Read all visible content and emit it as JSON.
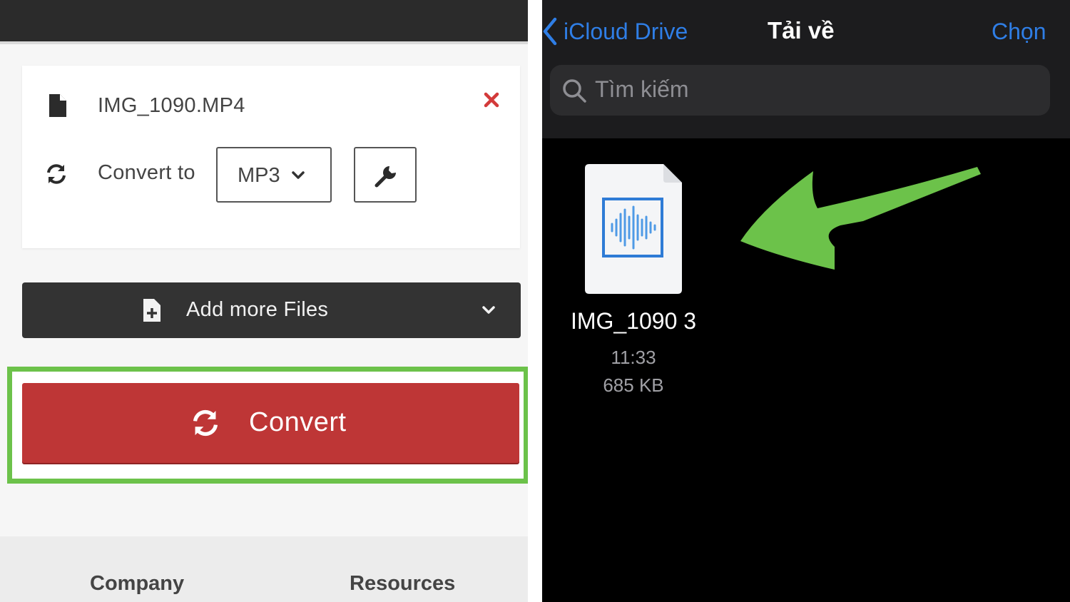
{
  "converter": {
    "file_name": "IMG_1090.MP4",
    "convert_to_label": "Convert to",
    "format_value": "MP3",
    "add_files_label": "Add more Files",
    "convert_label": "Convert",
    "footer": {
      "company": "Company",
      "resources": "Resources"
    },
    "colors": {
      "convert_button": "#be3636",
      "highlight": "#6cc24a",
      "add_files_button": "#333333"
    },
    "icons": [
      "file-icon",
      "remove-icon",
      "refresh-icon",
      "chevron-down-icon",
      "wrench-icon",
      "add-file-icon"
    ]
  },
  "files_app": {
    "back_label": "iCloud Drive",
    "title": "Tải về",
    "select_label": "Chọn",
    "search_placeholder": "Tìm kiếm",
    "file": {
      "name": "IMG_1090 3",
      "time": "11:33",
      "size": "685 KB"
    },
    "colors": {
      "accent": "#2f7ee6",
      "arrow": "#6cc24a"
    },
    "icons": [
      "chevron-left-icon",
      "search-icon",
      "audio-file-icon",
      "arrow-annotation"
    ]
  }
}
